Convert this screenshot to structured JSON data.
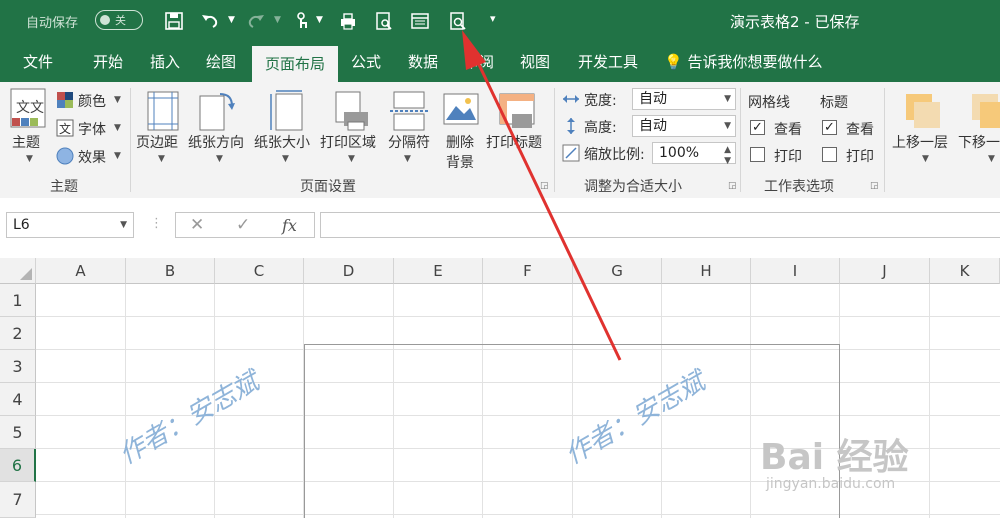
{
  "titlebar": {
    "autosave_label": "自动保存",
    "autosave_toggle": "关",
    "document_title": "演示表格2 - 已保存",
    "qat_icons": [
      "save-icon",
      "undo-icon",
      "redo-icon",
      "touch-mode-icon",
      "print-check-icon",
      "print-preview-icon",
      "page-layout-icon",
      "print-preview-zoom-icon",
      "customize-qat-icon"
    ]
  },
  "tabs": [
    "文件",
    "开始",
    "插入",
    "绘图",
    "页面布局",
    "公式",
    "数据",
    "审阅",
    "视图",
    "开发工具"
  ],
  "active_tab": "页面布局",
  "tell_me": "告诉我你想要做什么",
  "ribbon": {
    "theme_group": {
      "label": "主题",
      "theme_button": "主题",
      "colors": "颜色",
      "fonts": "字体",
      "effects": "效果"
    },
    "page_setup_group": {
      "label": "页面设置",
      "margins": "页边距",
      "orientation": "纸张方向",
      "size": "纸张大小",
      "print_area": "打印区域",
      "breaks": "分隔符",
      "background_line1": "删除",
      "background_line2": "背景",
      "print_titles": "打印标题"
    },
    "scale_group": {
      "label": "调整为合适大小",
      "width_label": "宽度:",
      "width_value": "自动",
      "height_label": "高度:",
      "height_value": "自动",
      "scale_label": "缩放比例:",
      "scale_value": "100%"
    },
    "sheet_options_group": {
      "label": "工作表选项",
      "gridlines": "网格线",
      "headings": "标题",
      "view": "查看",
      "print": "打印"
    },
    "arrange_group": {
      "bring_forward": "上移一层",
      "send_backward": "下移一"
    }
  },
  "formula_bar": {
    "name_box": "L6",
    "cancel": "✕",
    "enter": "✓",
    "fx": "fx",
    "content": ""
  },
  "sheet": {
    "columns": [
      "A",
      "B",
      "C",
      "D",
      "E",
      "F",
      "G",
      "H",
      "I",
      "J",
      "K"
    ],
    "rows": [
      "1",
      "2",
      "3",
      "4",
      "5",
      "6",
      "7"
    ],
    "selected_row": "6"
  },
  "watermark": {
    "author": "作者：安志斌",
    "baidu_logo": "Bai 经验",
    "baidu_url": "jingyan.baidu.com"
  },
  "colors": {
    "excel_green": "#217346",
    "arrow_red": "#e0322f"
  }
}
